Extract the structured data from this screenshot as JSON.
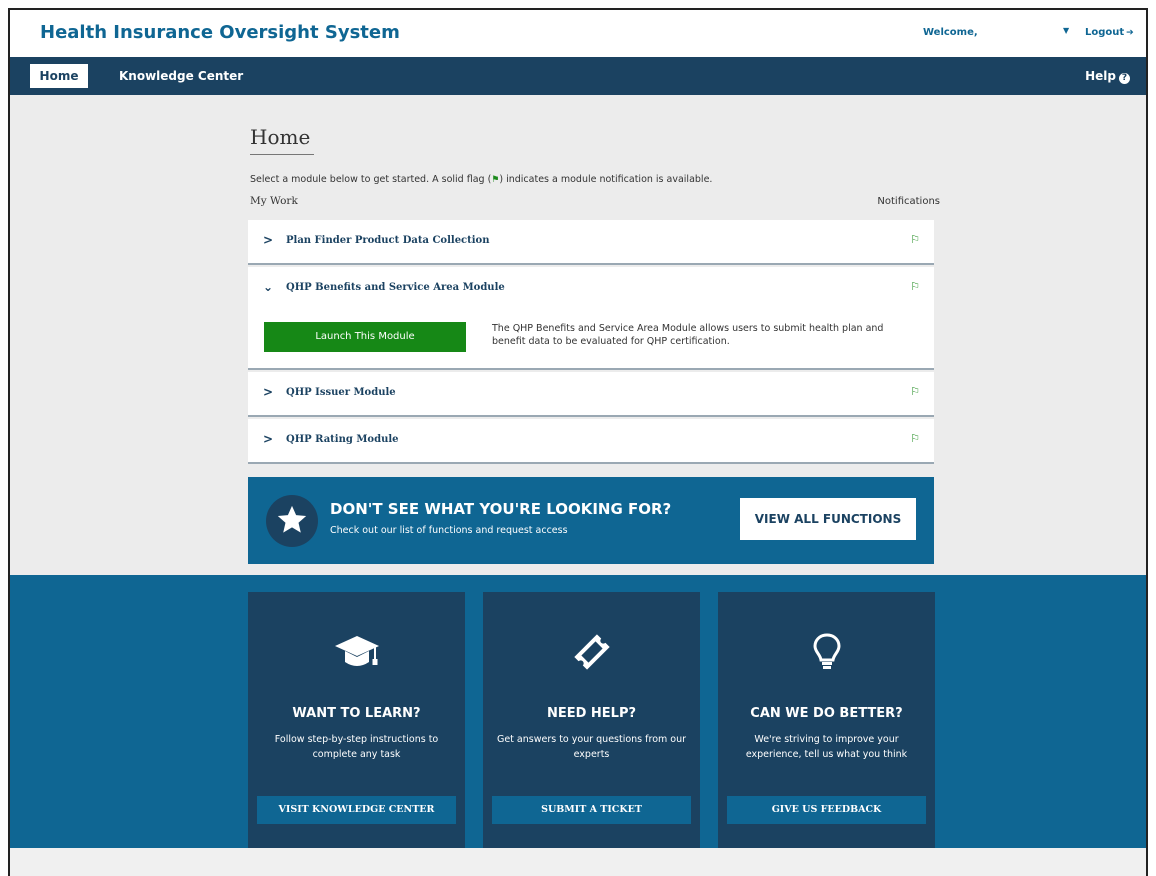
{
  "header": {
    "app_title": "Health Insurance Oversight System",
    "welcome": "Welcome,",
    "logout": "Logout"
  },
  "nav": {
    "home": "Home",
    "knowledge_center": "Knowledge Center",
    "help": "Help"
  },
  "main": {
    "title": "Home",
    "instructions_before": "Select a module below to get started. A solid flag (",
    "instructions_after": ") indicates a module notification is available.",
    "my_work": "My Work",
    "notifications": "Notifications",
    "modules": [
      {
        "title": "Plan Finder Product Data Collection",
        "expanded": false
      },
      {
        "title": "QHP Benefits and Service Area Module",
        "expanded": true,
        "launch_label": "Launch This Module",
        "description": "The QHP Benefits and Service Area Module allows users to submit health plan and benefit data to be evaluated for QHP certification."
      },
      {
        "title": "QHP Issuer Module",
        "expanded": false
      },
      {
        "title": "QHP Rating Module",
        "expanded": false
      }
    ]
  },
  "cta": {
    "heading": "DON'T SEE WHAT YOU'RE LOOKING FOR?",
    "subtext": "Check out our list of functions and request access",
    "button": "VIEW ALL FUNCTIONS"
  },
  "cards": [
    {
      "icon": "graduation-cap-icon",
      "title": "WANT TO LEARN?",
      "text": "Follow step-by-step instructions to complete any task",
      "button": "VISIT KNOWLEDGE CENTER"
    },
    {
      "icon": "ticket-icon",
      "title": "NEED HELP?",
      "text": "Get answers to your questions from our experts",
      "button": "SUBMIT A TICKET"
    },
    {
      "icon": "lightbulb-icon",
      "title": "CAN WE DO BETTER?",
      "text": "We're striving to improve your experience, tell us what you think",
      "button": "GIVE US FEEDBACK"
    }
  ],
  "colors": {
    "brand_blue": "#0f6693",
    "nav_navy": "#1b4261",
    "launch_green": "#168816",
    "flag_green": "#1c8a1c"
  }
}
